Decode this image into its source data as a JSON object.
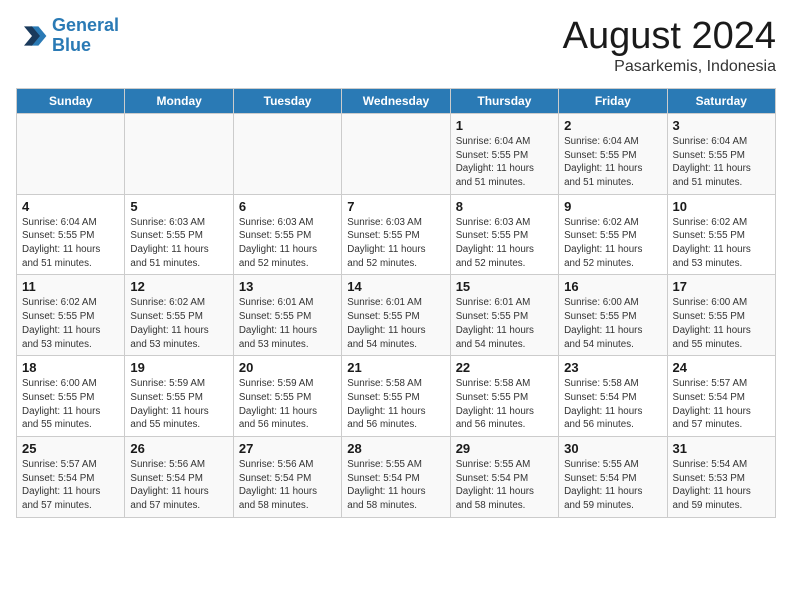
{
  "logo": {
    "line1": "General",
    "line2": "Blue"
  },
  "title": "August 2024",
  "subtitle": "Pasarkemis, Indonesia",
  "days_of_week": [
    "Sunday",
    "Monday",
    "Tuesday",
    "Wednesday",
    "Thursday",
    "Friday",
    "Saturday"
  ],
  "weeks": [
    [
      {
        "day": "",
        "info": ""
      },
      {
        "day": "",
        "info": ""
      },
      {
        "day": "",
        "info": ""
      },
      {
        "day": "",
        "info": ""
      },
      {
        "day": "1",
        "info": "Sunrise: 6:04 AM\nSunset: 5:55 PM\nDaylight: 11 hours\nand 51 minutes."
      },
      {
        "day": "2",
        "info": "Sunrise: 6:04 AM\nSunset: 5:55 PM\nDaylight: 11 hours\nand 51 minutes."
      },
      {
        "day": "3",
        "info": "Sunrise: 6:04 AM\nSunset: 5:55 PM\nDaylight: 11 hours\nand 51 minutes."
      }
    ],
    [
      {
        "day": "4",
        "info": "Sunrise: 6:04 AM\nSunset: 5:55 PM\nDaylight: 11 hours\nand 51 minutes."
      },
      {
        "day": "5",
        "info": "Sunrise: 6:03 AM\nSunset: 5:55 PM\nDaylight: 11 hours\nand 51 minutes."
      },
      {
        "day": "6",
        "info": "Sunrise: 6:03 AM\nSunset: 5:55 PM\nDaylight: 11 hours\nand 52 minutes."
      },
      {
        "day": "7",
        "info": "Sunrise: 6:03 AM\nSunset: 5:55 PM\nDaylight: 11 hours\nand 52 minutes."
      },
      {
        "day": "8",
        "info": "Sunrise: 6:03 AM\nSunset: 5:55 PM\nDaylight: 11 hours\nand 52 minutes."
      },
      {
        "day": "9",
        "info": "Sunrise: 6:02 AM\nSunset: 5:55 PM\nDaylight: 11 hours\nand 52 minutes."
      },
      {
        "day": "10",
        "info": "Sunrise: 6:02 AM\nSunset: 5:55 PM\nDaylight: 11 hours\nand 53 minutes."
      }
    ],
    [
      {
        "day": "11",
        "info": "Sunrise: 6:02 AM\nSunset: 5:55 PM\nDaylight: 11 hours\nand 53 minutes."
      },
      {
        "day": "12",
        "info": "Sunrise: 6:02 AM\nSunset: 5:55 PM\nDaylight: 11 hours\nand 53 minutes."
      },
      {
        "day": "13",
        "info": "Sunrise: 6:01 AM\nSunset: 5:55 PM\nDaylight: 11 hours\nand 53 minutes."
      },
      {
        "day": "14",
        "info": "Sunrise: 6:01 AM\nSunset: 5:55 PM\nDaylight: 11 hours\nand 54 minutes."
      },
      {
        "day": "15",
        "info": "Sunrise: 6:01 AM\nSunset: 5:55 PM\nDaylight: 11 hours\nand 54 minutes."
      },
      {
        "day": "16",
        "info": "Sunrise: 6:00 AM\nSunset: 5:55 PM\nDaylight: 11 hours\nand 54 minutes."
      },
      {
        "day": "17",
        "info": "Sunrise: 6:00 AM\nSunset: 5:55 PM\nDaylight: 11 hours\nand 55 minutes."
      }
    ],
    [
      {
        "day": "18",
        "info": "Sunrise: 6:00 AM\nSunset: 5:55 PM\nDaylight: 11 hours\nand 55 minutes."
      },
      {
        "day": "19",
        "info": "Sunrise: 5:59 AM\nSunset: 5:55 PM\nDaylight: 11 hours\nand 55 minutes."
      },
      {
        "day": "20",
        "info": "Sunrise: 5:59 AM\nSunset: 5:55 PM\nDaylight: 11 hours\nand 56 minutes."
      },
      {
        "day": "21",
        "info": "Sunrise: 5:58 AM\nSunset: 5:55 PM\nDaylight: 11 hours\nand 56 minutes."
      },
      {
        "day": "22",
        "info": "Sunrise: 5:58 AM\nSunset: 5:55 PM\nDaylight: 11 hours\nand 56 minutes."
      },
      {
        "day": "23",
        "info": "Sunrise: 5:58 AM\nSunset: 5:54 PM\nDaylight: 11 hours\nand 56 minutes."
      },
      {
        "day": "24",
        "info": "Sunrise: 5:57 AM\nSunset: 5:54 PM\nDaylight: 11 hours\nand 57 minutes."
      }
    ],
    [
      {
        "day": "25",
        "info": "Sunrise: 5:57 AM\nSunset: 5:54 PM\nDaylight: 11 hours\nand 57 minutes."
      },
      {
        "day": "26",
        "info": "Sunrise: 5:56 AM\nSunset: 5:54 PM\nDaylight: 11 hours\nand 57 minutes."
      },
      {
        "day": "27",
        "info": "Sunrise: 5:56 AM\nSunset: 5:54 PM\nDaylight: 11 hours\nand 58 minutes."
      },
      {
        "day": "28",
        "info": "Sunrise: 5:55 AM\nSunset: 5:54 PM\nDaylight: 11 hours\nand 58 minutes."
      },
      {
        "day": "29",
        "info": "Sunrise: 5:55 AM\nSunset: 5:54 PM\nDaylight: 11 hours\nand 58 minutes."
      },
      {
        "day": "30",
        "info": "Sunrise: 5:55 AM\nSunset: 5:54 PM\nDaylight: 11 hours\nand 59 minutes."
      },
      {
        "day": "31",
        "info": "Sunrise: 5:54 AM\nSunset: 5:53 PM\nDaylight: 11 hours\nand 59 minutes."
      }
    ]
  ]
}
